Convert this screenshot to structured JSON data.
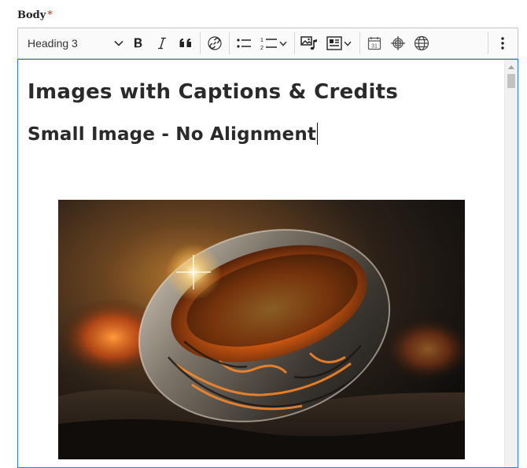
{
  "field": {
    "label": "Body",
    "required_mark": "*"
  },
  "toolbar": {
    "heading_value": "Heading 3",
    "buttons": [
      "bold",
      "italic",
      "blockquote",
      "link",
      "bulleted-list",
      "numbered-list",
      "media",
      "insert-block",
      "date",
      "layout",
      "language",
      "more"
    ],
    "icons": {
      "bold": "bold-icon",
      "italic": "italic-icon",
      "blockquote": "quote-icon",
      "link": "link-icon",
      "bulleted_list": "bulleted-list-icon",
      "numbered_list": "numbered-list-icon",
      "media": "media-icon",
      "insert_block": "insert-block-icon",
      "calendar": "calendar-icon",
      "crosshair": "crosshair-icon",
      "globe": "globe-icon",
      "more": "more-vertical-icon"
    },
    "calendar_day": "31"
  },
  "editor": {
    "heading_2": "Images with Captions & Credits",
    "heading_3": "Small Image - No Alignment",
    "image_subject": "glowing ornate ring on dark rocks"
  },
  "colors": {
    "accent_border": "#2977ff",
    "required": "#d72222",
    "text": "#2a2a2a"
  }
}
